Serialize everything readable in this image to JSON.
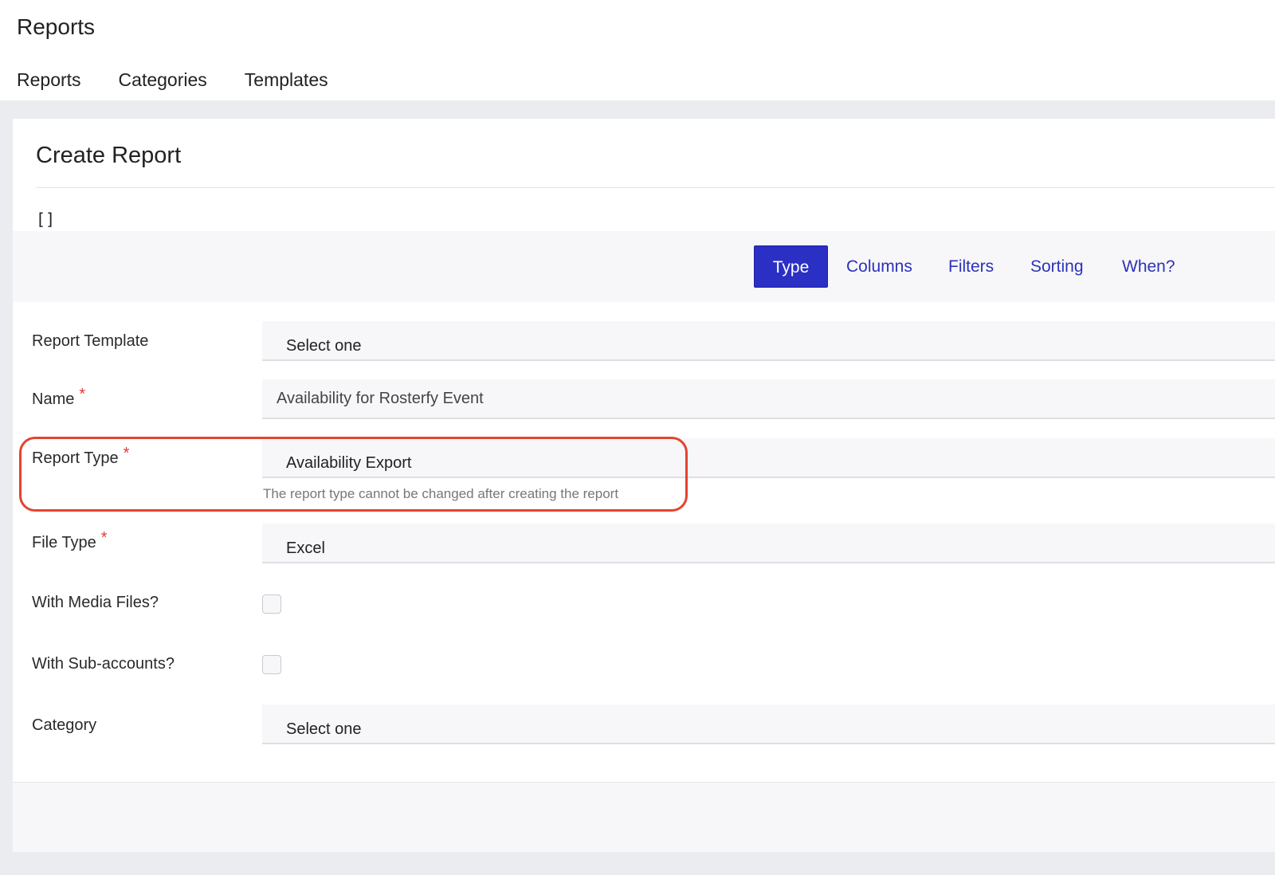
{
  "app": {
    "title": "Reports"
  },
  "nav": [
    {
      "label": "Reports"
    },
    {
      "label": "Categories"
    },
    {
      "label": "Templates"
    }
  ],
  "card": {
    "title": "Create Report",
    "debug_text": "[]"
  },
  "tabs": [
    {
      "label": "Type",
      "active": true
    },
    {
      "label": "Columns",
      "active": false
    },
    {
      "label": "Filters",
      "active": false
    },
    {
      "label": "Sorting",
      "active": false
    },
    {
      "label": "When?",
      "active": false
    }
  ],
  "form": {
    "report_template": {
      "label": "Report Template",
      "value": "Select one"
    },
    "name": {
      "label": "Name",
      "required_mark": "*",
      "value": "Availability for Rosterfy Event"
    },
    "report_type": {
      "label": "Report Type",
      "required_mark": "*",
      "value": "Availability Export",
      "hint": "The report type cannot be changed after creating the report"
    },
    "file_type": {
      "label": "File Type",
      "required_mark": "*",
      "value": "Excel"
    },
    "with_media_files": {
      "label": "With Media Files?",
      "checked": false
    },
    "with_sub_accounts": {
      "label": "With Sub-accounts?",
      "checked": false
    },
    "category": {
      "label": "Category",
      "value": "Select one"
    }
  },
  "colors": {
    "accent": "#2b2fc4",
    "link": "#2d32b8",
    "required": "#e43a3a",
    "highlight": "#e5432e",
    "page_background": "#ebecef"
  }
}
